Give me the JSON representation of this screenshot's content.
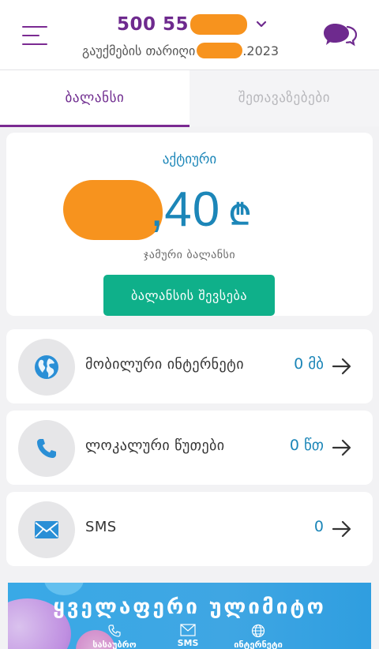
{
  "header": {
    "phone_visible": "500 55",
    "expiry_label": "გაუქმების თარიღი",
    "expiry_year": ".2023"
  },
  "tabs": [
    {
      "label": "ბალანსი",
      "active": true
    },
    {
      "label": "შეთავაზებები",
      "active": false
    }
  ],
  "balance": {
    "status": "აქტიური",
    "amount_visible": ",40",
    "currency": "₾",
    "label": "ჯამური ბალანსი",
    "topup_label": "ბალანსის შევსება"
  },
  "usage": [
    {
      "icon": "globe-icon",
      "label": "მობილური ინტერნეტი",
      "value": "0 მბ"
    },
    {
      "icon": "phone-icon",
      "label": "ლოკალური წუთები",
      "value": "0 წთ"
    },
    {
      "icon": "envelope-icon",
      "label": "SMS",
      "value": "0"
    }
  ],
  "banner": {
    "title": "ყველაფერი ულიმიტო",
    "items": [
      "სასაუბრო",
      "SMS",
      "ინტერნეტი"
    ]
  },
  "colors": {
    "brand_purple": "#6e2a8e",
    "accent_blue": "#1c86b8",
    "topup_green": "#0fb08a",
    "redaction_orange": "#f7931e"
  }
}
